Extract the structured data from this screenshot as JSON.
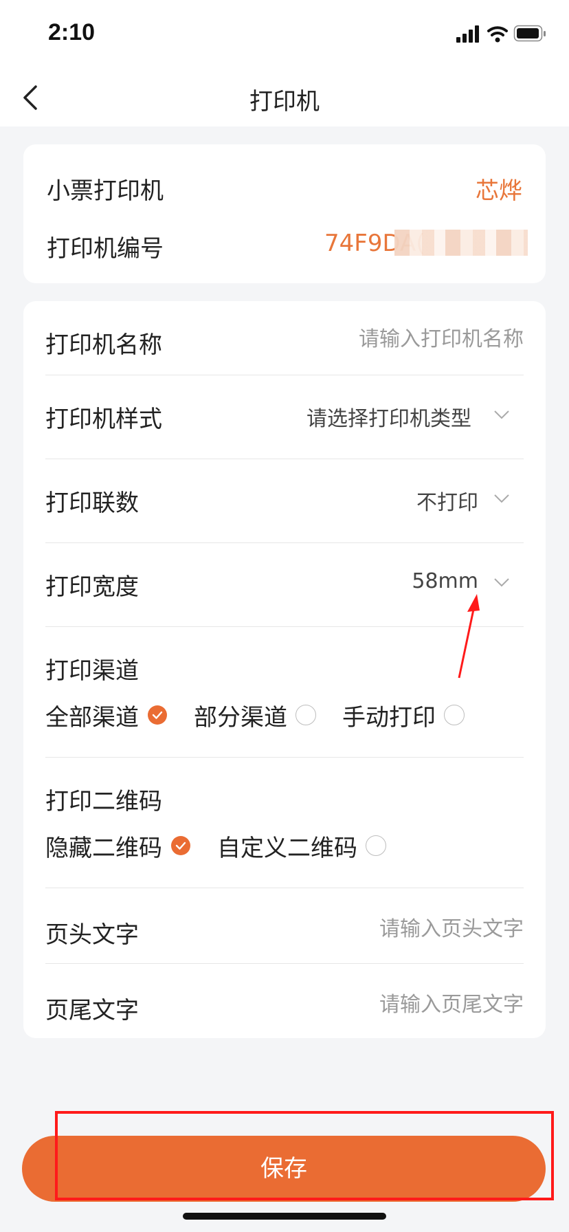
{
  "status_bar": {
    "time": "2:10"
  },
  "nav": {
    "title": "打印机"
  },
  "info_card": {
    "type_label": "小票打印机",
    "brand": "芯烨",
    "serial_label": "打印机编号",
    "serial_value": "74F9DA("
  },
  "form": {
    "name": {
      "label": "打印机名称",
      "placeholder": "请输入打印机名称"
    },
    "style": {
      "label": "打印机样式",
      "value": "请选择打印机类型"
    },
    "copies": {
      "label": "打印联数",
      "value": "不打印"
    },
    "width": {
      "label": "打印宽度",
      "value": "58mm"
    },
    "channel": {
      "label": "打印渠道",
      "options": [
        {
          "label": "全部渠道",
          "checked": true
        },
        {
          "label": "部分渠道",
          "checked": false
        },
        {
          "label": "手动打印",
          "checked": false
        }
      ]
    },
    "qrcode": {
      "label": "打印二维码",
      "options": [
        {
          "label": "隐藏二维码",
          "checked": true
        },
        {
          "label": "自定义二维码",
          "checked": false
        }
      ]
    },
    "header_text": {
      "label": "页头文字",
      "placeholder": "请输入页头文字"
    },
    "footer_text": {
      "label": "页尾文字",
      "placeholder": "请输入页尾文字"
    }
  },
  "save_button": {
    "label": "保存"
  },
  "colors": {
    "accent": "#ea6c33",
    "brand_text": "#e8763a",
    "annotation": "#ff1a1a"
  }
}
